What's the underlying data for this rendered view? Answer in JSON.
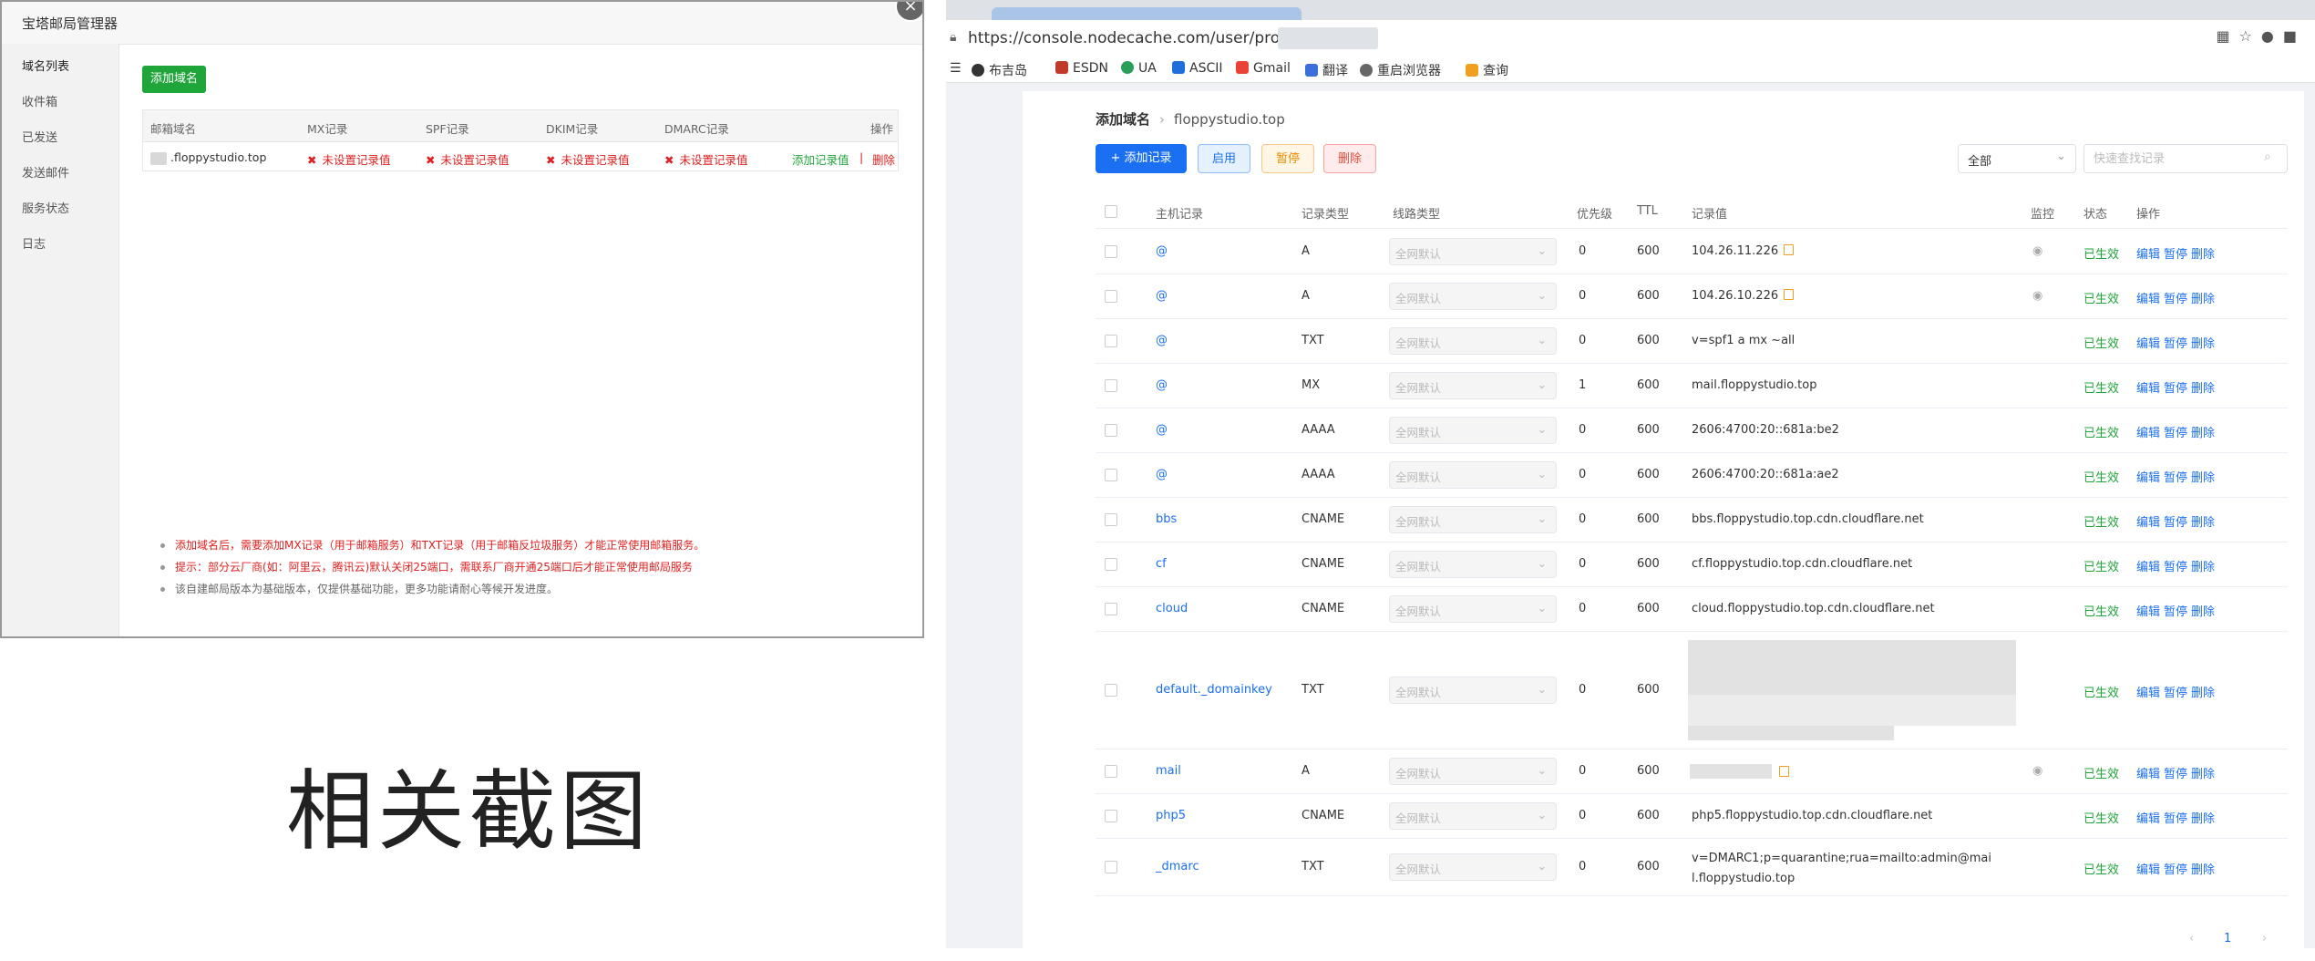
{
  "mail_manager": {
    "title": "宝塔邮局管理器",
    "sidebar": [
      "域名列表",
      "收件箱",
      "已发送",
      "发送邮件",
      "服务状态",
      "日志"
    ],
    "add_domain_label": "添加域名",
    "table": {
      "headers": [
        "邮箱域名",
        "MX记录",
        "SPF记录",
        "DKIM记录",
        "DMARC记录",
        "操作"
      ],
      "row": {
        "domain": ".floppystudio.top",
        "mx": "未设置记录值",
        "spf": "未设置记录值",
        "dkim": "未设置记录值",
        "dmarc": "未设置记录值",
        "action_add": "添加记录值",
        "action_sep": "|",
        "action_delete": "删除"
      }
    },
    "notes": [
      "添加域名后，需要添加MX记录（用于邮箱服务）和TXT记录（用于邮箱反垃圾服务）才能正常使用邮箱服务。",
      "提示：部分云厂商(如：阿里云，腾讯云)默认关闭25端口，需联系厂商开通25端口后才能正常使用邮局服务",
      "该自建邮局版本为基础版本，仅提供基础功能，更多功能请耐心等候开发进度。"
    ]
  },
  "caption": "相关截图",
  "browser": {
    "url": "https://console.nodecache.com/user/product/dns/",
    "bookmarks": [
      "布吉岛",
      "ESDN",
      "UA",
      "ASCII",
      "Gmail",
      "翻译",
      "重启浏览器",
      "查询"
    ]
  },
  "dns": {
    "breadcrumb": [
      "添加域名",
      "floppystudio.top"
    ],
    "buttons": {
      "add": "+ 添加记录",
      "enable": "启用",
      "pause": "暂停",
      "delete": "删除"
    },
    "filter_value": "全部",
    "search_placeholder": "快速查找记录",
    "headers": {
      "host": "主机记录",
      "type": "记录类型",
      "line": "线路类型",
      "priority": "优先级",
      "ttl": "TTL",
      "value": "记录值",
      "monitor": "监控",
      "status": "状态",
      "ops": "操作"
    },
    "line_default": "全网默认",
    "status_text": "已生效",
    "ops": [
      "编辑",
      "暂停",
      "删除"
    ],
    "records": [
      {
        "host": "@",
        "type": "A",
        "priority": "0",
        "ttl": "600",
        "value": "104.26.11.226",
        "monitor": true,
        "tag": true
      },
      {
        "host": "@",
        "type": "A",
        "priority": "0",
        "ttl": "600",
        "value": "104.26.10.226",
        "monitor": true,
        "tag": true
      },
      {
        "host": "@",
        "type": "TXT",
        "priority": "0",
        "ttl": "600",
        "value": "v=spf1 a mx ~all"
      },
      {
        "host": "@",
        "type": "MX",
        "priority": "1",
        "ttl": "600",
        "value": "mail.floppystudio.top"
      },
      {
        "host": "@",
        "type": "AAAA",
        "priority": "0",
        "ttl": "600",
        "value": "2606:4700:20::681a:be2"
      },
      {
        "host": "@",
        "type": "AAAA",
        "priority": "0",
        "ttl": "600",
        "value": "2606:4700:20::681a:ae2"
      },
      {
        "host": "bbs",
        "type": "CNAME",
        "priority": "0",
        "ttl": "600",
        "value": "bbs.floppystudio.top.cdn.cloudflare.net"
      },
      {
        "host": "cf",
        "type": "CNAME",
        "priority": "0",
        "ttl": "600",
        "value": "cf.floppystudio.top.cdn.cloudflare.net"
      },
      {
        "host": "cloud",
        "type": "CNAME",
        "priority": "0",
        "ttl": "600",
        "value": "cloud.floppystudio.top.cdn.cloudflare.net"
      },
      {
        "host": "default._domainkey",
        "type": "TXT",
        "priority": "0",
        "ttl": "600",
        "value": "",
        "tall": true
      },
      {
        "host": "mail",
        "type": "A",
        "priority": "0",
        "ttl": "600",
        "value": "",
        "monitor": true,
        "tag": true
      },
      {
        "host": "php5",
        "type": "CNAME",
        "priority": "0",
        "ttl": "600",
        "value": "php5.floppystudio.top.cdn.cloudflare.net"
      },
      {
        "host": "_dmarc",
        "type": "TXT",
        "priority": "0",
        "ttl": "600",
        "value": "v=DMARC1;p=quarantine;rua=mailto:admin@mail.floppystudio.top",
        "wrap": true
      }
    ],
    "pagination": {
      "prev": "‹",
      "current": "1",
      "next": "›"
    }
  }
}
